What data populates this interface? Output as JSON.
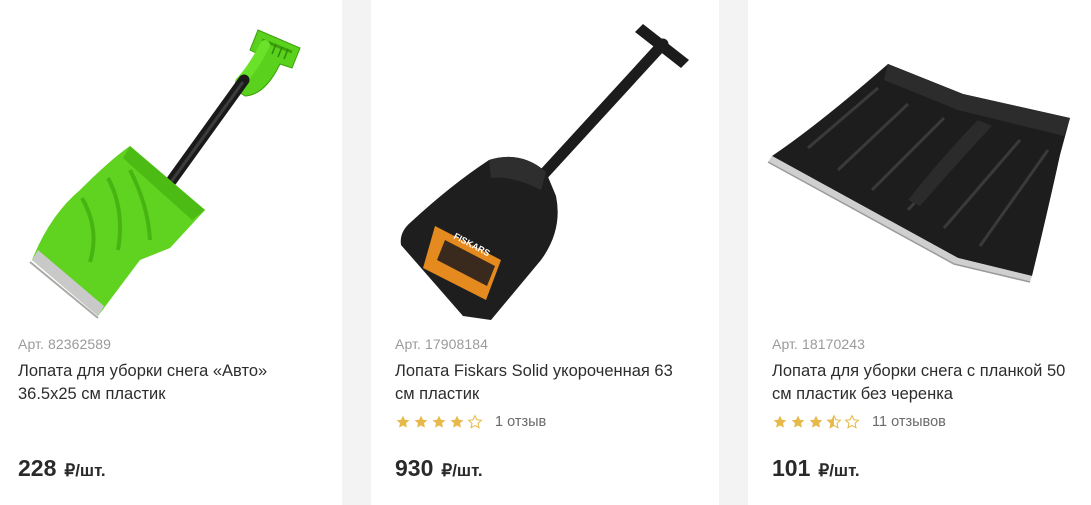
{
  "products": [
    {
      "sku": "Арт. 82362589",
      "title": "Лопата для уборки снега «Авто» 36.5x25 см пластик",
      "price": "228",
      "unit": "₽/шт.",
      "image_icon": "green-snow-shovel-image"
    },
    {
      "sku": "Арт. 17908184",
      "title": "Лопата Fiskars Solid укороченная 63 см пластик",
      "rating": 4,
      "reviews": "1 отзыв",
      "price": "930",
      "unit": "₽/шт.",
      "image_icon": "black-fiskars-shovel-image",
      "label_text": "FISKARS"
    },
    {
      "sku": "Арт. 18170243",
      "title": "Лопата для уборки снега с планкой 50 см пластик без черенка",
      "rating": 3.5,
      "reviews": "11 отзывов",
      "price": "101",
      "unit": "₽/шт.",
      "image_icon": "black-shovel-blade-image"
    }
  ],
  "colors": {
    "star": "#e7b94a",
    "star_empty": "#e7b94a",
    "shovel_green": "#5fd320",
    "background": "#f3f3f3"
  }
}
